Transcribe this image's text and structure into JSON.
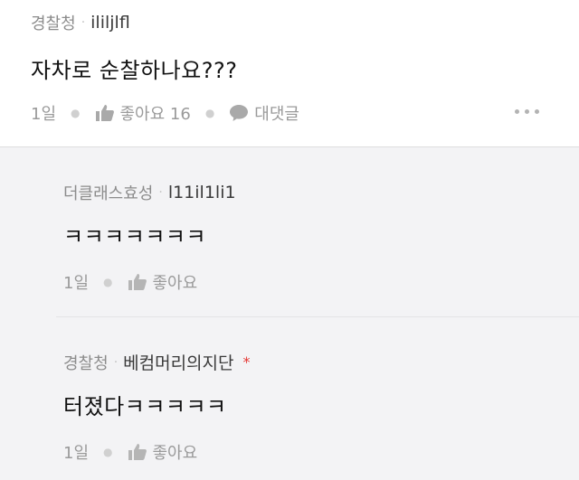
{
  "post": {
    "author": "경찰청",
    "uid": "ililjlfl",
    "text": "자차로 순찰하나요???",
    "time": "1일",
    "like_label": "좋아요 16",
    "reply_label": "대댓글"
  },
  "replies": [
    {
      "author": "더클래스효성",
      "uid": "l11il1li1",
      "text": "ㅋㅋㅋㅋㅋㅋㅋ",
      "time": "1일",
      "like_label": "좋아요"
    },
    {
      "author": "경찰청",
      "uid": "베컴머리의지단",
      "star": "*",
      "text": "터졌다ㅋㅋㅋㅋㅋ",
      "time": "1일",
      "like_label": "좋아요"
    }
  ],
  "colors": {
    "accent_star": "#e53935",
    "reply_bg": "#f3f3f5"
  }
}
